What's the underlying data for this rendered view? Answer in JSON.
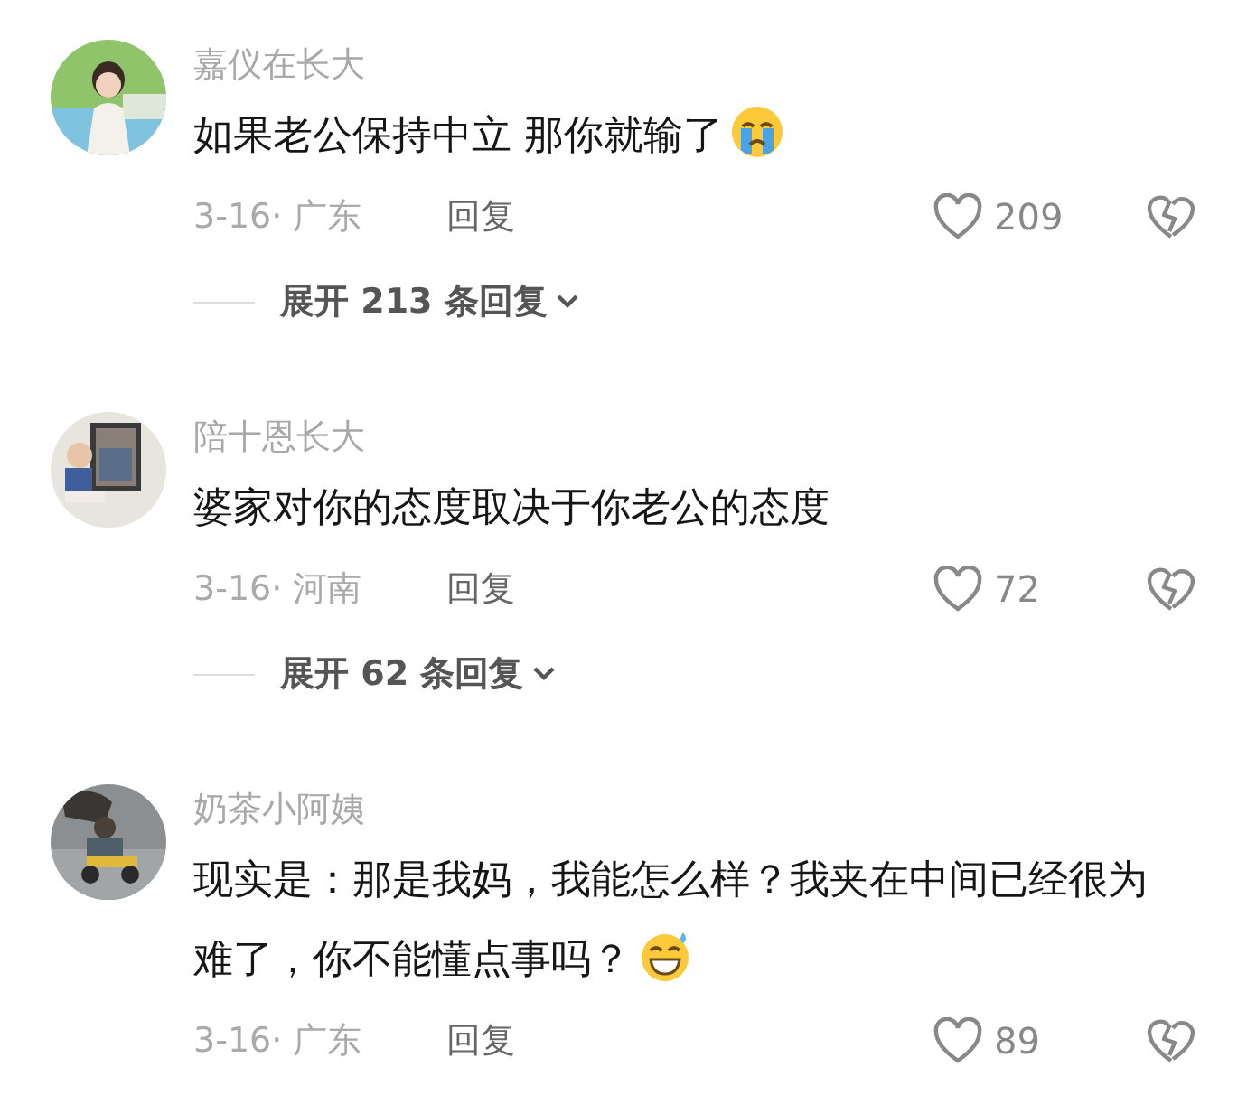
{
  "comments": [
    {
      "username": "嘉仪在长大",
      "text": "如果老公保持中立 那你就输了",
      "emoji": {
        "kind": "crying"
      },
      "date": "3-16· 广东",
      "reply": "回复",
      "likes": "209",
      "expand": "展开 213 条回复"
    },
    {
      "username": "陪十恩长大",
      "text": "婆家对你的态度取决于你老公的态度",
      "date": "3-16· 河南",
      "reply": "回复",
      "likes": "72",
      "expand": "展开 62 条回复"
    },
    {
      "username": "奶茶小阿姨",
      "text": "现实是：那是我妈，我能怎么样？我夹在中间已经很为难了，你不能懂点事吗？",
      "emoji": {
        "kind": "sweat-grin"
      },
      "date": "3-16· 广东",
      "reply": "回复",
      "likes": "89"
    }
  ]
}
